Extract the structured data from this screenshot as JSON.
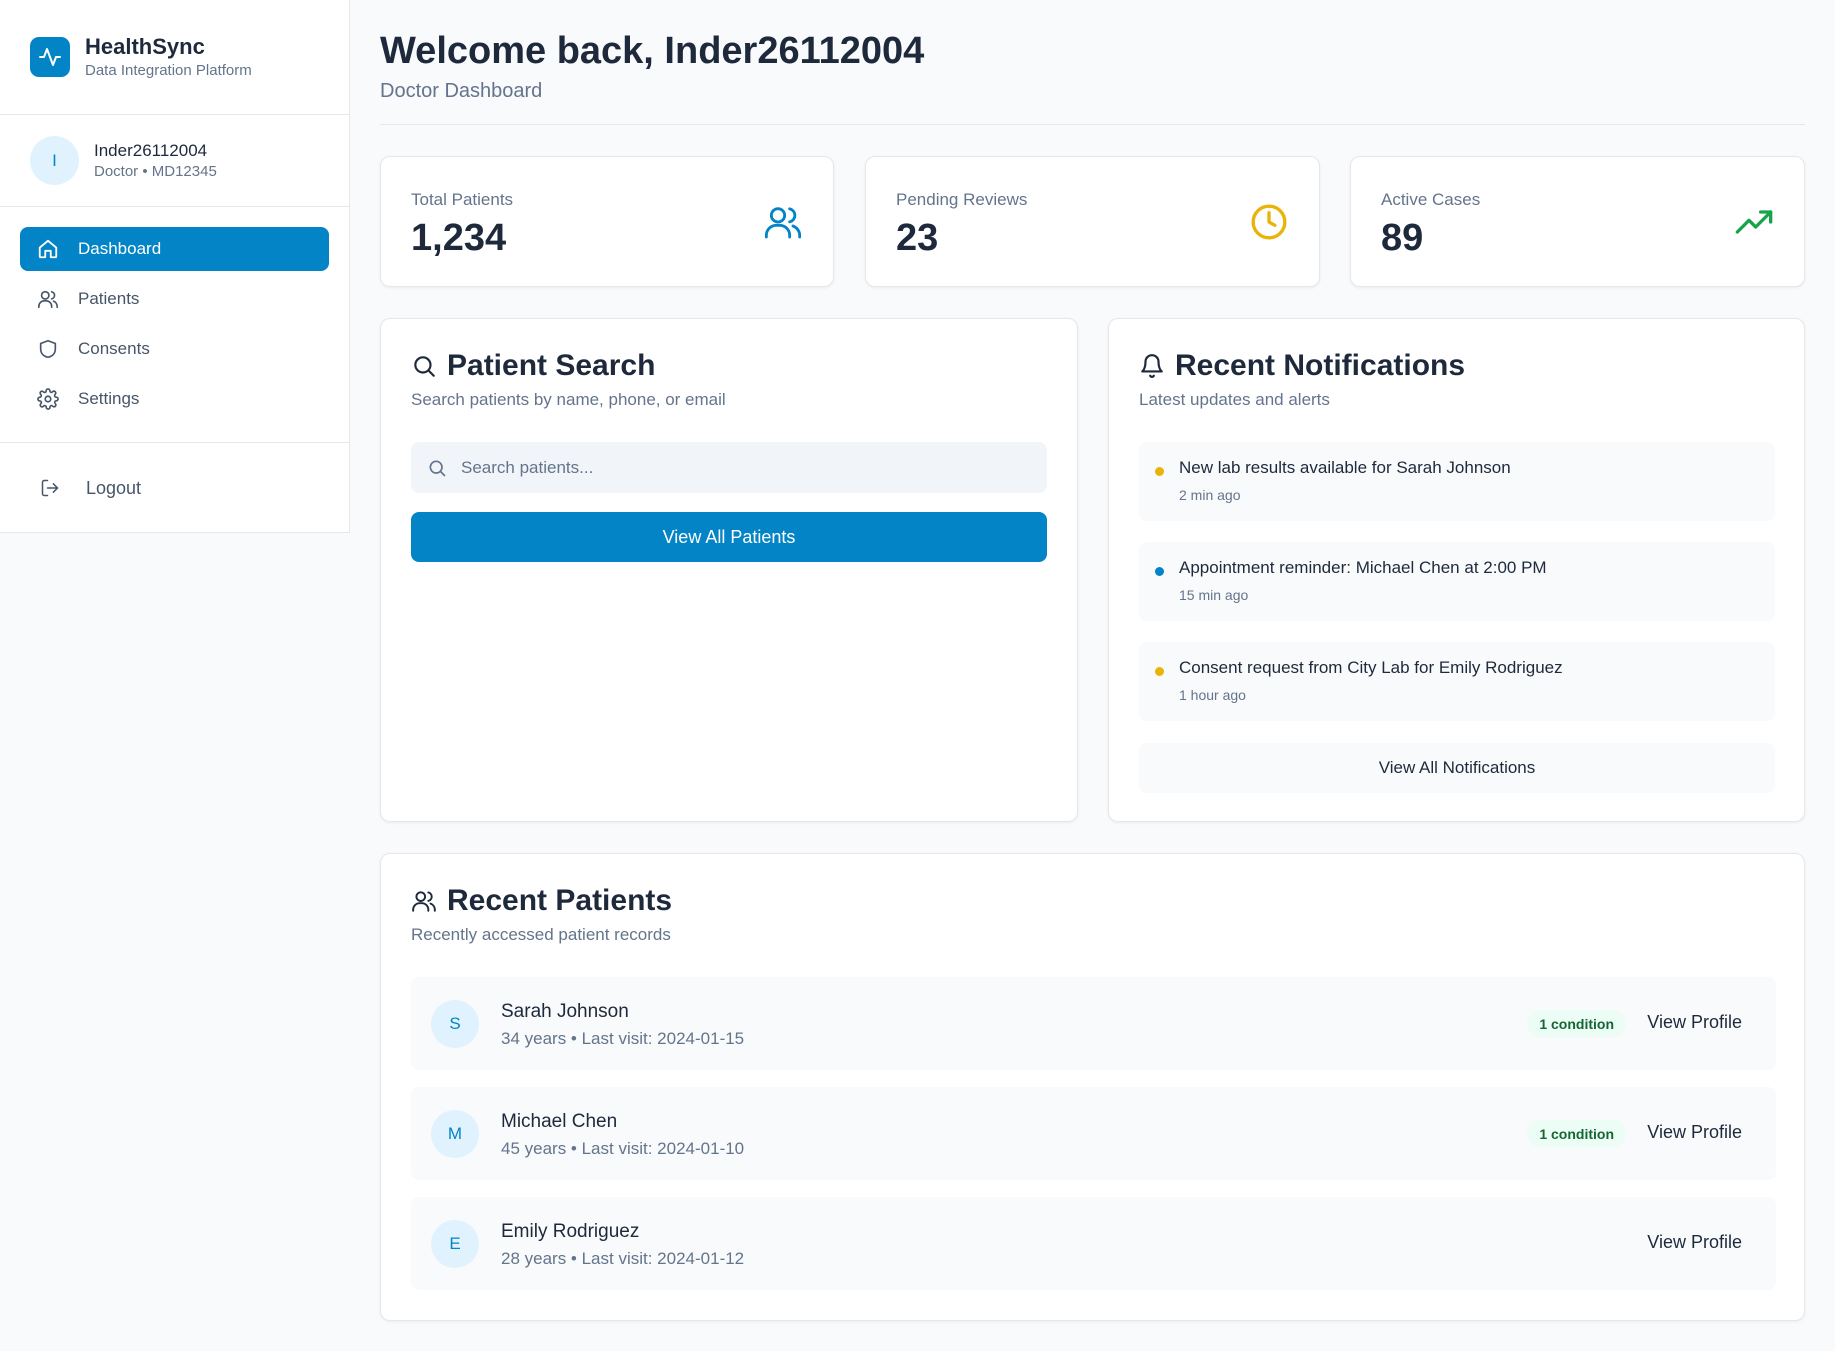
{
  "brand": {
    "name": "HealthSync",
    "subtitle": "Data Integration Platform"
  },
  "user": {
    "initial": "I",
    "name": "Inder26112004",
    "role": "Doctor • MD12345"
  },
  "nav": [
    {
      "label": "Dashboard",
      "icon": "home-icon",
      "active": true
    },
    {
      "label": "Patients",
      "icon": "users-icon"
    },
    {
      "label": "Consents",
      "icon": "shield-icon"
    },
    {
      "label": "Settings",
      "icon": "gear-icon"
    }
  ],
  "logout_label": "Logout",
  "header": {
    "title": "Welcome back, Inder26112004",
    "subtitle": "Doctor Dashboard"
  },
  "stats": [
    {
      "label": "Total Patients",
      "value": "1,234",
      "icon": "users-icon",
      "color": "#0284c7"
    },
    {
      "label": "Pending Reviews",
      "value": "23",
      "icon": "clock-icon",
      "color": "#eab308"
    },
    {
      "label": "Active Cases",
      "value": "89",
      "icon": "trending-up-icon",
      "color": "#16a34a"
    }
  ],
  "search": {
    "title": "Patient Search",
    "subtitle": "Search patients by name, phone, or email",
    "placeholder": "Search patients...",
    "button": "View All Patients"
  },
  "notifications": {
    "title": "Recent Notifications",
    "subtitle": "Latest updates and alerts",
    "items": [
      {
        "text": "New lab results available for Sarah Johnson",
        "time": "2 min ago",
        "color": "#eab308"
      },
      {
        "text": "Appointment reminder: Michael Chen at 2:00 PM",
        "time": "15 min ago",
        "color": "#0284c7"
      },
      {
        "text": "Consent request from City Lab for Emily Rodriguez",
        "time": "1 hour ago",
        "color": "#eab308"
      }
    ],
    "button": "View All Notifications"
  },
  "recent": {
    "title": "Recent Patients",
    "subtitle": "Recently accessed patient records",
    "patients": [
      {
        "initial": "S",
        "name": "Sarah Johnson",
        "meta": "34 years • Last visit: 2024-01-15",
        "badge": "1 condition",
        "link": "View Profile"
      },
      {
        "initial": "M",
        "name": "Michael Chen",
        "meta": "45 years • Last visit: 2024-01-10",
        "badge": "1 condition",
        "link": "View Profile"
      },
      {
        "initial": "E",
        "name": "Emily Rodriguez",
        "meta": "28 years • Last visit: 2024-01-12",
        "badge": "",
        "link": "View Profile"
      }
    ]
  },
  "colors": {
    "accent": "#0284c7",
    "warning": "#eab308",
    "success": "#16a34a"
  }
}
